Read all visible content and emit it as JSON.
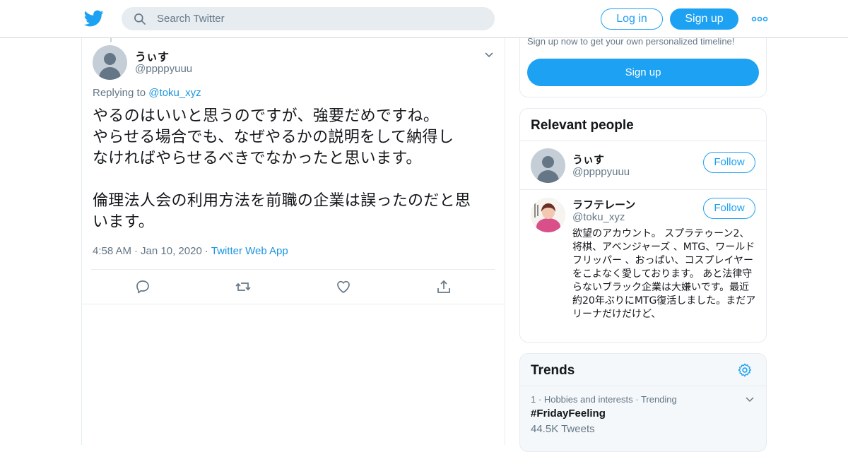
{
  "header": {
    "search_placeholder": "Search Twitter",
    "login_label": "Log in",
    "signup_label": "Sign up",
    "brand_color": "#1da1f2"
  },
  "tweet": {
    "author_name": "うぃす",
    "author_handle": "@ppppyuuu",
    "replying_prefix": "Replying to",
    "replying_to": "@toku_xyz",
    "text": "やるのはいいと思うのですが、強要だめですね。\nやらせる場合でも、なぜやるかの説明をして納得し\nなければやらせるべきでなかったと思います。\n\n倫理法人会の利用方法を前職の企業は誤ったのだと思\nいます。",
    "time": "4:58 AM",
    "date": "Jan 10, 2020",
    "source_app": "Twitter Web App",
    "actions": [
      "reply-icon",
      "retweet-icon",
      "like-icon",
      "share-icon"
    ]
  },
  "signup_card": {
    "text": "Sign up now to get your own personalized timeline!",
    "button_label": "Sign up"
  },
  "relevant_people": {
    "title": "Relevant people",
    "people": [
      {
        "name": "うぃす",
        "handle": "@ppppyuuu",
        "follow_label": "Follow"
      },
      {
        "name": "ラフテレーン",
        "handle": "@toku_xyz",
        "follow_label": "Follow",
        "bio": "欲望のアカウント。 スプラテゥーン2、将棋、アベンジャーズ 、MTG、ワールドフリッパー 、おっぱい、コスプレイヤーをこよなく愛しております。 あと法律守らないブラック企業は大嫌いです。最近約20年ぶりにMTG復活しました。まだアリーナだけだけど、"
      }
    ]
  },
  "trends": {
    "title": "Trends",
    "items": [
      {
        "rank": "1",
        "category": "Hobbies and interests",
        "status": "Trending",
        "name": "#FridayFeeling",
        "count": "44.5K Tweets"
      }
    ]
  }
}
